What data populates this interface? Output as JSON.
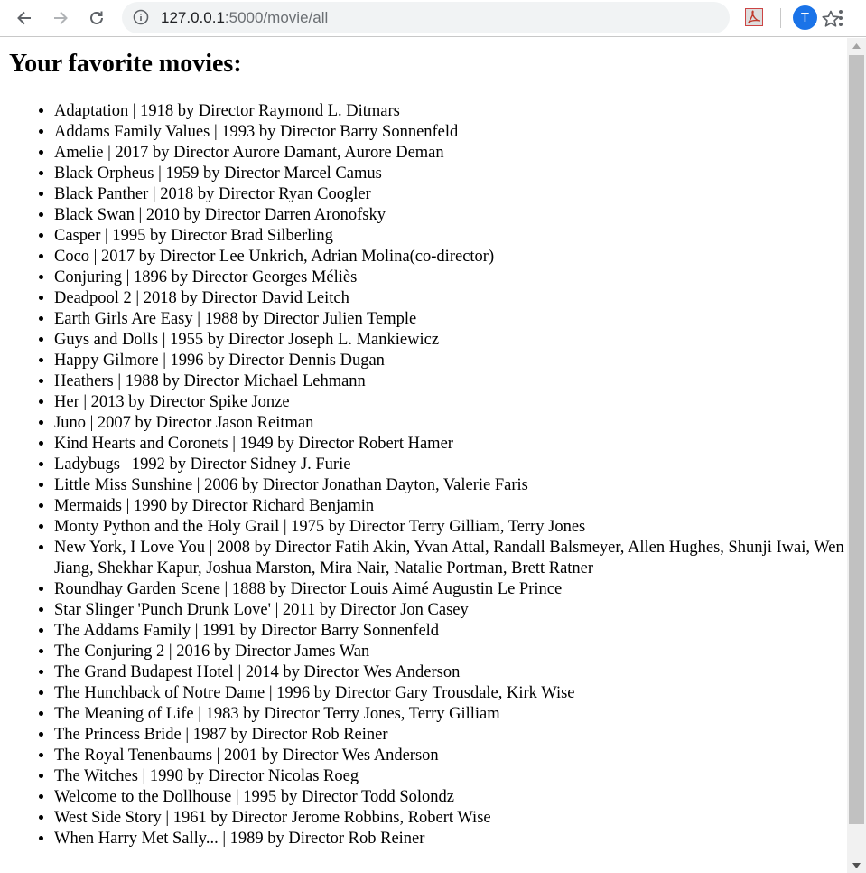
{
  "browser": {
    "url_host": "127.0.0.1",
    "url_rest": ":5000/movie/all",
    "profile_initial": "T"
  },
  "page": {
    "heading": "Your favorite movies:",
    "movies": [
      "Adaptation | 1918 by Director Raymond L. Ditmars",
      "Addams Family Values | 1993 by Director Barry Sonnenfeld",
      "Amelie | 2017 by Director Aurore Damant, Aurore Deman",
      "Black Orpheus | 1959 by Director Marcel Camus",
      "Black Panther | 2018 by Director Ryan Coogler",
      "Black Swan | 2010 by Director Darren Aronofsky",
      "Casper | 1995 by Director Brad Silberling",
      "Coco | 2017 by Director Lee Unkrich, Adrian Molina(co-director)",
      "Conjuring | 1896 by Director Georges Méliès",
      "Deadpool 2 | 2018 by Director David Leitch",
      "Earth Girls Are Easy | 1988 by Director Julien Temple",
      "Guys and Dolls | 1955 by Director Joseph L. Mankiewicz",
      "Happy Gilmore | 1996 by Director Dennis Dugan",
      "Heathers | 1988 by Director Michael Lehmann",
      "Her | 2013 by Director Spike Jonze",
      "Juno | 2007 by Director Jason Reitman",
      "Kind Hearts and Coronets | 1949 by Director Robert Hamer",
      "Ladybugs | 1992 by Director Sidney J. Furie",
      "Little Miss Sunshine | 2006 by Director Jonathan Dayton, Valerie Faris",
      "Mermaids | 1990 by Director Richard Benjamin",
      "Monty Python and the Holy Grail | 1975 by Director Terry Gilliam, Terry Jones",
      "New York, I Love You | 2008 by Director Fatih Akin, Yvan Attal, Randall Balsmeyer, Allen Hughes, Shunji Iwai, Wen Jiang, Shekhar Kapur, Joshua Marston, Mira Nair, Natalie Portman, Brett Ratner",
      "Roundhay Garden Scene | 1888 by Director Louis Aimé Augustin Le Prince",
      "Star Slinger 'Punch Drunk Love' | 2011 by Director Jon Casey",
      "The Addams Family | 1991 by Director Barry Sonnenfeld",
      "The Conjuring 2 | 2016 by Director James Wan",
      "The Grand Budapest Hotel | 2014 by Director Wes Anderson",
      "The Hunchback of Notre Dame | 1996 by Director Gary Trousdale, Kirk Wise",
      "The Meaning of Life | 1983 by Director Terry Jones, Terry Gilliam",
      "The Princess Bride | 1987 by Director Rob Reiner",
      "The Royal Tenenbaums | 2001 by Director Wes Anderson",
      "The Witches | 1990 by Director Nicolas Roeg",
      "Welcome to the Dollhouse | 1995 by Director Todd Solondz",
      "West Side Story | 1961 by Director Jerome Robbins, Robert Wise",
      "When Harry Met Sally... | 1989 by Director Rob Reiner"
    ]
  },
  "colors": {
    "omnibox_bg": "#f1f3f4",
    "avatar_bg": "#1a73e8",
    "scroll_thumb": "#c1c1c1"
  }
}
